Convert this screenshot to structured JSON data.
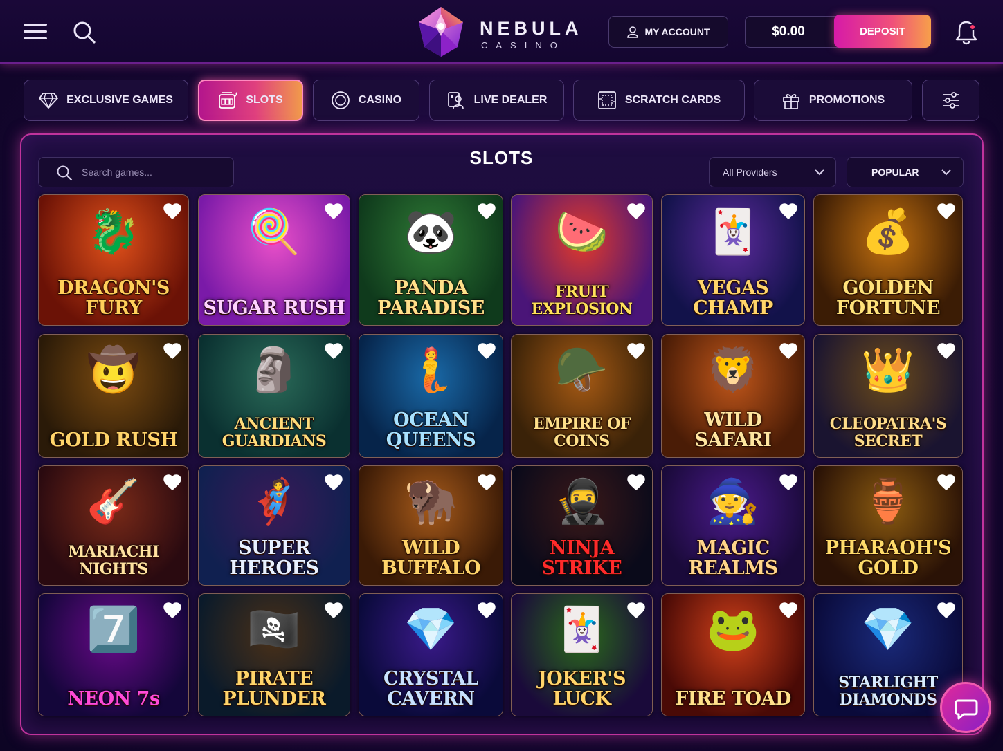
{
  "header": {
    "logo_word": "NEBULA",
    "logo_sub": "CASINO",
    "account_label": "MY ACCOUNT",
    "balance": "$0.00",
    "deposit_label": "DEPOSIT",
    "icons": [
      "menu-icon",
      "search-icon",
      "user-icon",
      "bell-icon"
    ]
  },
  "nav": {
    "categories": [
      {
        "label": "EXCLUSIVE GAMES",
        "icon": "diamond-icon",
        "active": false
      },
      {
        "label": "SLOTS",
        "icon": "slot-machine-icon",
        "active": true
      },
      {
        "label": "CASINO",
        "icon": "chip-icon",
        "active": false
      },
      {
        "label": "LIVE DEALER",
        "icon": "dealer-icon",
        "active": false
      },
      {
        "label": "SCRATCH CARDS",
        "icon": "scratch-card-icon",
        "active": false
      },
      {
        "label": "PROMOTIONS",
        "icon": "gift-icon",
        "active": false
      }
    ],
    "filter_icon": "sliders-icon"
  },
  "panel": {
    "title": "SLOTS",
    "search_placeholder": "Search games...",
    "provider_select": "All Providers",
    "sort_select": "POPULAR"
  },
  "colors": {
    "accent_pink": "#d61aa8",
    "accent_orange": "#f7a04a",
    "background": "#170733",
    "panel_border": "#c0339c"
  },
  "games": [
    {
      "title": "DRAGON'S FURY",
      "emblem": "🐉",
      "favorited": true
    },
    {
      "title": "SUGAR RUSH",
      "emblem": "🍭",
      "favorited": true
    },
    {
      "title": "PANDA PARADISE",
      "emblem": "🐼",
      "favorited": true
    },
    {
      "title": "FRUIT EXPLOSION",
      "emblem": "🍉",
      "favorited": true
    },
    {
      "title": "VEGAS CHAMP",
      "emblem": "🃏",
      "favorited": true
    },
    {
      "title": "GOLDEN FORTUNE",
      "emblem": "💰",
      "favorited": true
    },
    {
      "title": "GOLD RUSH",
      "emblem": "🤠",
      "favorited": true
    },
    {
      "title": "ANCIENT GUARDIANS",
      "emblem": "🗿",
      "favorited": true
    },
    {
      "title": "OCEAN QUEENS",
      "emblem": "🧜",
      "favorited": true
    },
    {
      "title": "EMPIRE OF COINS",
      "emblem": "🪖",
      "favorited": true
    },
    {
      "title": "WILD SAFARI",
      "emblem": "🦁",
      "favorited": true
    },
    {
      "title": "CLEOPATRA'S SECRET",
      "emblem": "👑",
      "favorited": true
    },
    {
      "title": "MARIACHI NIGHTS",
      "emblem": "🎸",
      "favorited": true
    },
    {
      "title": "SUPER HEROES",
      "emblem": "🦸",
      "favorited": true
    },
    {
      "title": "WILD BUFFALO",
      "emblem": "🦬",
      "favorited": true
    },
    {
      "title": "NINJA STRIKE",
      "emblem": "🥷",
      "favorited": true
    },
    {
      "title": "MAGIC REALMS",
      "emblem": "🧙",
      "favorited": true
    },
    {
      "title": "PHARAOH'S GOLD",
      "emblem": "🏺",
      "favorited": true
    },
    {
      "title": "NEON 7s",
      "emblem": "7️⃣",
      "favorited": true
    },
    {
      "title": "PIRATE PLUNDER",
      "emblem": "🏴‍☠️",
      "favorited": true
    },
    {
      "title": "CRYSTAL CAVERN",
      "emblem": "💎",
      "favorited": true
    },
    {
      "title": "JOKER'S LUCK",
      "emblem": "🃏",
      "favorited": true
    },
    {
      "title": "FIRE TOAD",
      "emblem": "🐸",
      "favorited": true
    },
    {
      "title": "STARLIGHT DIAMONDS",
      "emblem": "💎",
      "favorited": true
    }
  ],
  "chat_icon": "chat-bubble-icon"
}
